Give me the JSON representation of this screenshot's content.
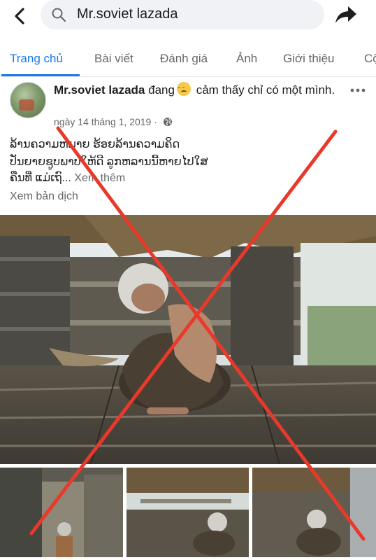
{
  "search": {
    "query": "Mr.soviet lazada"
  },
  "tabs": [
    {
      "label": "Trang chủ",
      "active": true
    },
    {
      "label": "Bài viết"
    },
    {
      "label": "Đánh giá"
    },
    {
      "label": "Ảnh"
    },
    {
      "label": "Giới thiệu"
    },
    {
      "label": "Cộ"
    }
  ],
  "post": {
    "author": "Mr.soviet lazada",
    "status_prefix": "đang",
    "status_text": "cảm thấy chỉ có một mình.",
    "date": "ngày 14 tháng 1, 2019 ·",
    "text_line1": "ລ້ານຄວາມຫມາຍ ຮ້ອຍລ້ານຄວາມຄິດ",
    "text_line2": "ປັນຍາຍຊູບພາບໃຫ້ດີ ລູກຫລານນີ້ຫາຍໄປໃສ",
    "text_line3": "ຄືນທີ່ ແມ່ເຖົ...",
    "see_more": "Xem thêm",
    "translate": "Xem bản dịch"
  },
  "icons": {
    "back": "back-arrow-icon",
    "search": "search-icon",
    "share": "share-arrow-icon",
    "more": "more-dots-icon",
    "globe": "globe-icon",
    "emoji": "sad-emoji-icon"
  },
  "colors": {
    "accent": "#1877f2",
    "cross": "#e8392b",
    "secondary_text": "#65676b"
  }
}
